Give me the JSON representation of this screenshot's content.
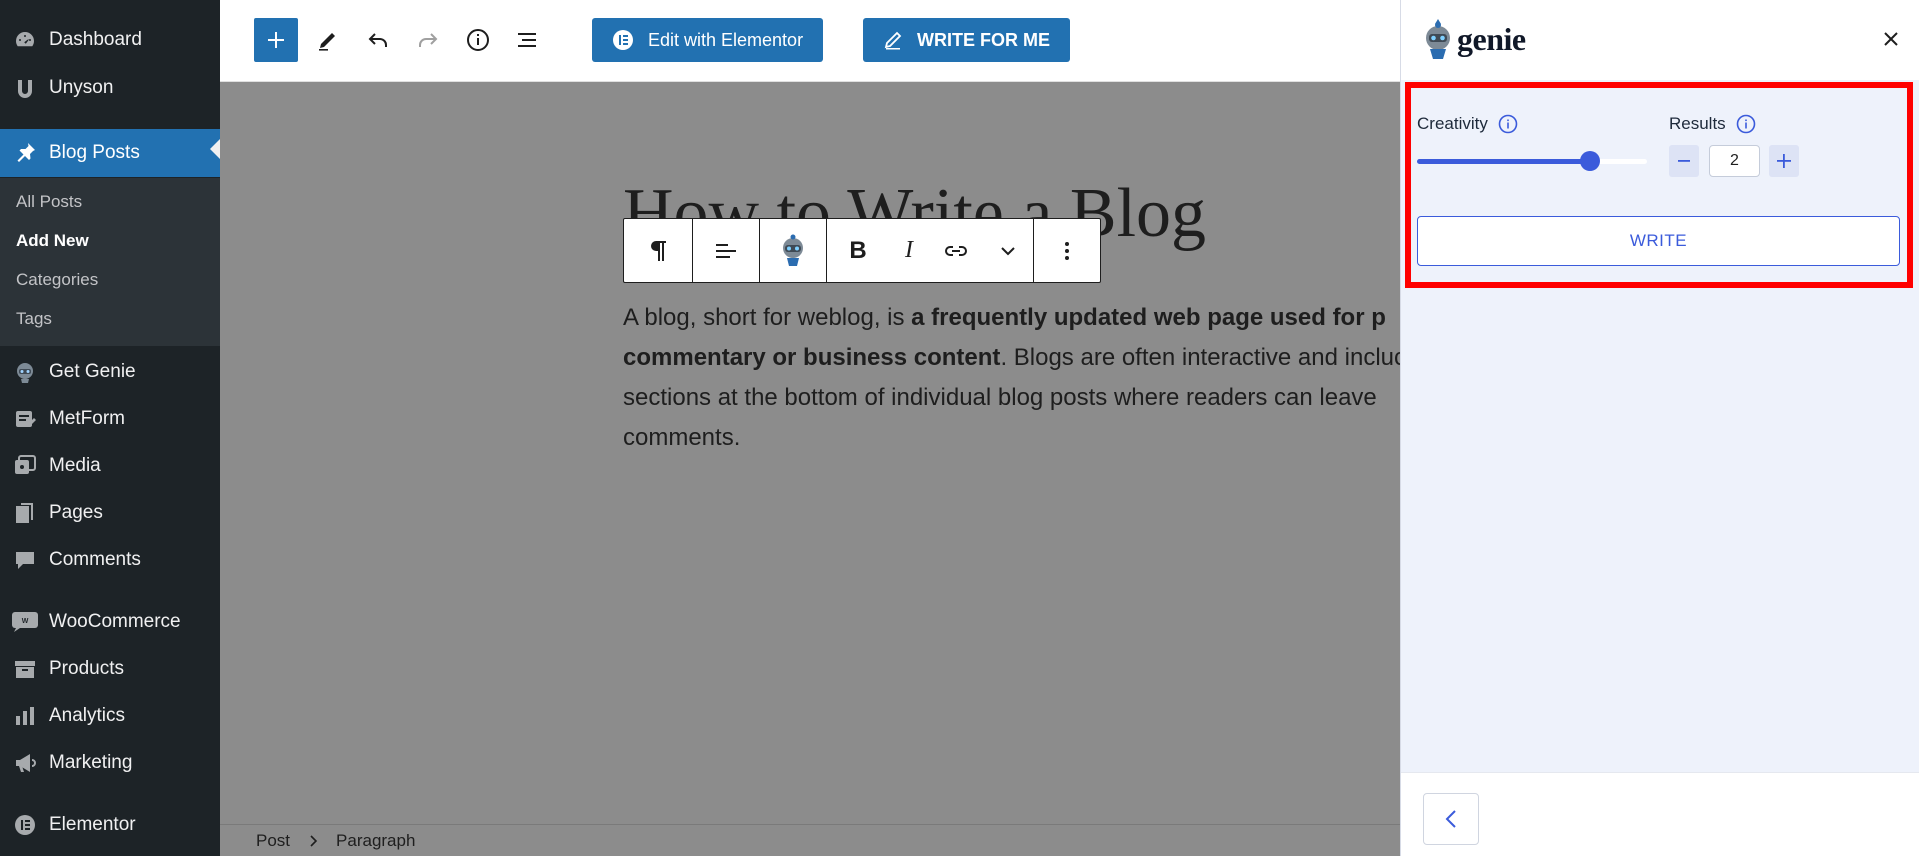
{
  "sidebar": {
    "items": [
      {
        "label": "Dashboard",
        "icon": "dashboard-icon"
      },
      {
        "label": "Unyson",
        "icon": "unyson-icon"
      },
      {
        "label": "Blog Posts",
        "icon": "pin-icon",
        "active": true
      },
      {
        "label": "Get Genie",
        "icon": "genie-icon"
      },
      {
        "label": "MetForm",
        "icon": "metform-icon"
      },
      {
        "label": "Media",
        "icon": "media-icon"
      },
      {
        "label": "Pages",
        "icon": "pages-icon"
      },
      {
        "label": "Comments",
        "icon": "comments-icon"
      },
      {
        "label": "WooCommerce",
        "icon": "woo-icon"
      },
      {
        "label": "Products",
        "icon": "products-icon"
      },
      {
        "label": "Analytics",
        "icon": "analytics-icon"
      },
      {
        "label": "Marketing",
        "icon": "megaphone-icon"
      },
      {
        "label": "Elementor",
        "icon": "elementor-icon"
      }
    ],
    "submenu": [
      "All Posts",
      "Add New",
      "Categories",
      "Tags"
    ]
  },
  "toolbar": {
    "elementor_label": "Edit with Elementor",
    "write_for_me_label": "WRITE FOR ME"
  },
  "post": {
    "title": "How to Write a Blog",
    "para_prefix": "A blog, short for weblog, is ",
    "para_bold_1": "a frequently updated web page used for p",
    "para_bold_2": "commentary or business content",
    "para_rest": ". Blogs are often interactive and incluc sections at the bottom of individual blog posts where readers can leave comments."
  },
  "breadcrumb": [
    "Post",
    "Paragraph"
  ],
  "panel": {
    "logo_text": "genie",
    "creativity_label": "Creativity",
    "creativity_level": 0.75,
    "results_label": "Results",
    "results_value": "2",
    "write_label": "WRITE"
  },
  "colors": {
    "wp_blue": "#2271b1",
    "sidebar_bg": "#1d2327",
    "genie_accent": "#3b5bdb",
    "highlight": "#ff0000"
  }
}
